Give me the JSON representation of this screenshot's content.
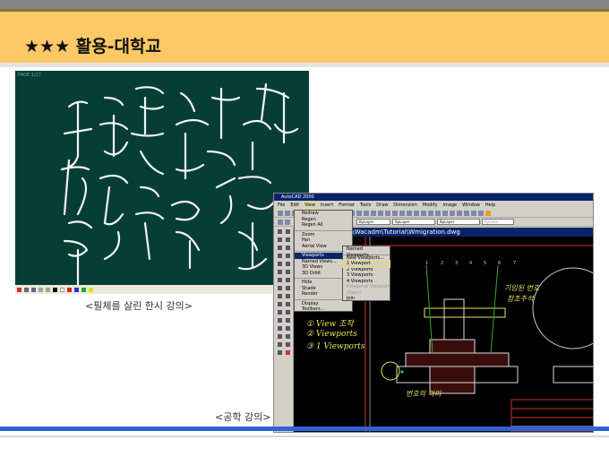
{
  "slide": {
    "title": "★★★ 활용-대학교",
    "caption_left": "<필체를 살린 한시 강의>",
    "caption_right": "<공학 강의>"
  },
  "board": {
    "page_label": "PAGE 1/17"
  },
  "cad": {
    "window_title": "AutoCAD 2000",
    "menu": [
      "File",
      "Edit",
      "View",
      "Insert",
      "Format",
      "Tools",
      "Draw",
      "Dimension",
      "Modify",
      "Image",
      "Window",
      "Help"
    ],
    "layer_selects": [
      "ByLayer",
      "ByLayer",
      "ByLayer",
      "ByColor"
    ],
    "drawing_title": "C:\\Wacadm\\Tutorial\\Wmigration.dwg",
    "view_menu": [
      "Redraw",
      "Regen",
      "Regen All",
      "Zoom",
      "Pan",
      "Aerial View",
      "Viewports",
      "Named Views...",
      "3D Views",
      "3D Orbit",
      "Hide",
      "Shade",
      "Render",
      "Display",
      "Toolbars..."
    ],
    "viewports_submenu": [
      "Named Viewports...",
      "New Viewports...",
      "1 Viewport",
      "2 Viewports",
      "3 Viewports",
      "4 Viewports",
      "Polygonal Viewport",
      "Object",
      "Join"
    ],
    "notes": [
      "① View 조작",
      "② Viewports",
      "③ 1 Viewports",
      "기입된 번호",
      "참조주석",
      "번호의 의미"
    ],
    "balloons": [
      "1",
      "2",
      "3",
      "4",
      "5",
      "6",
      "7"
    ],
    "colors": {
      "title_bar": "#0a246a",
      "highlight": "#0a246a",
      "annotation": "#e6e35a"
    }
  }
}
